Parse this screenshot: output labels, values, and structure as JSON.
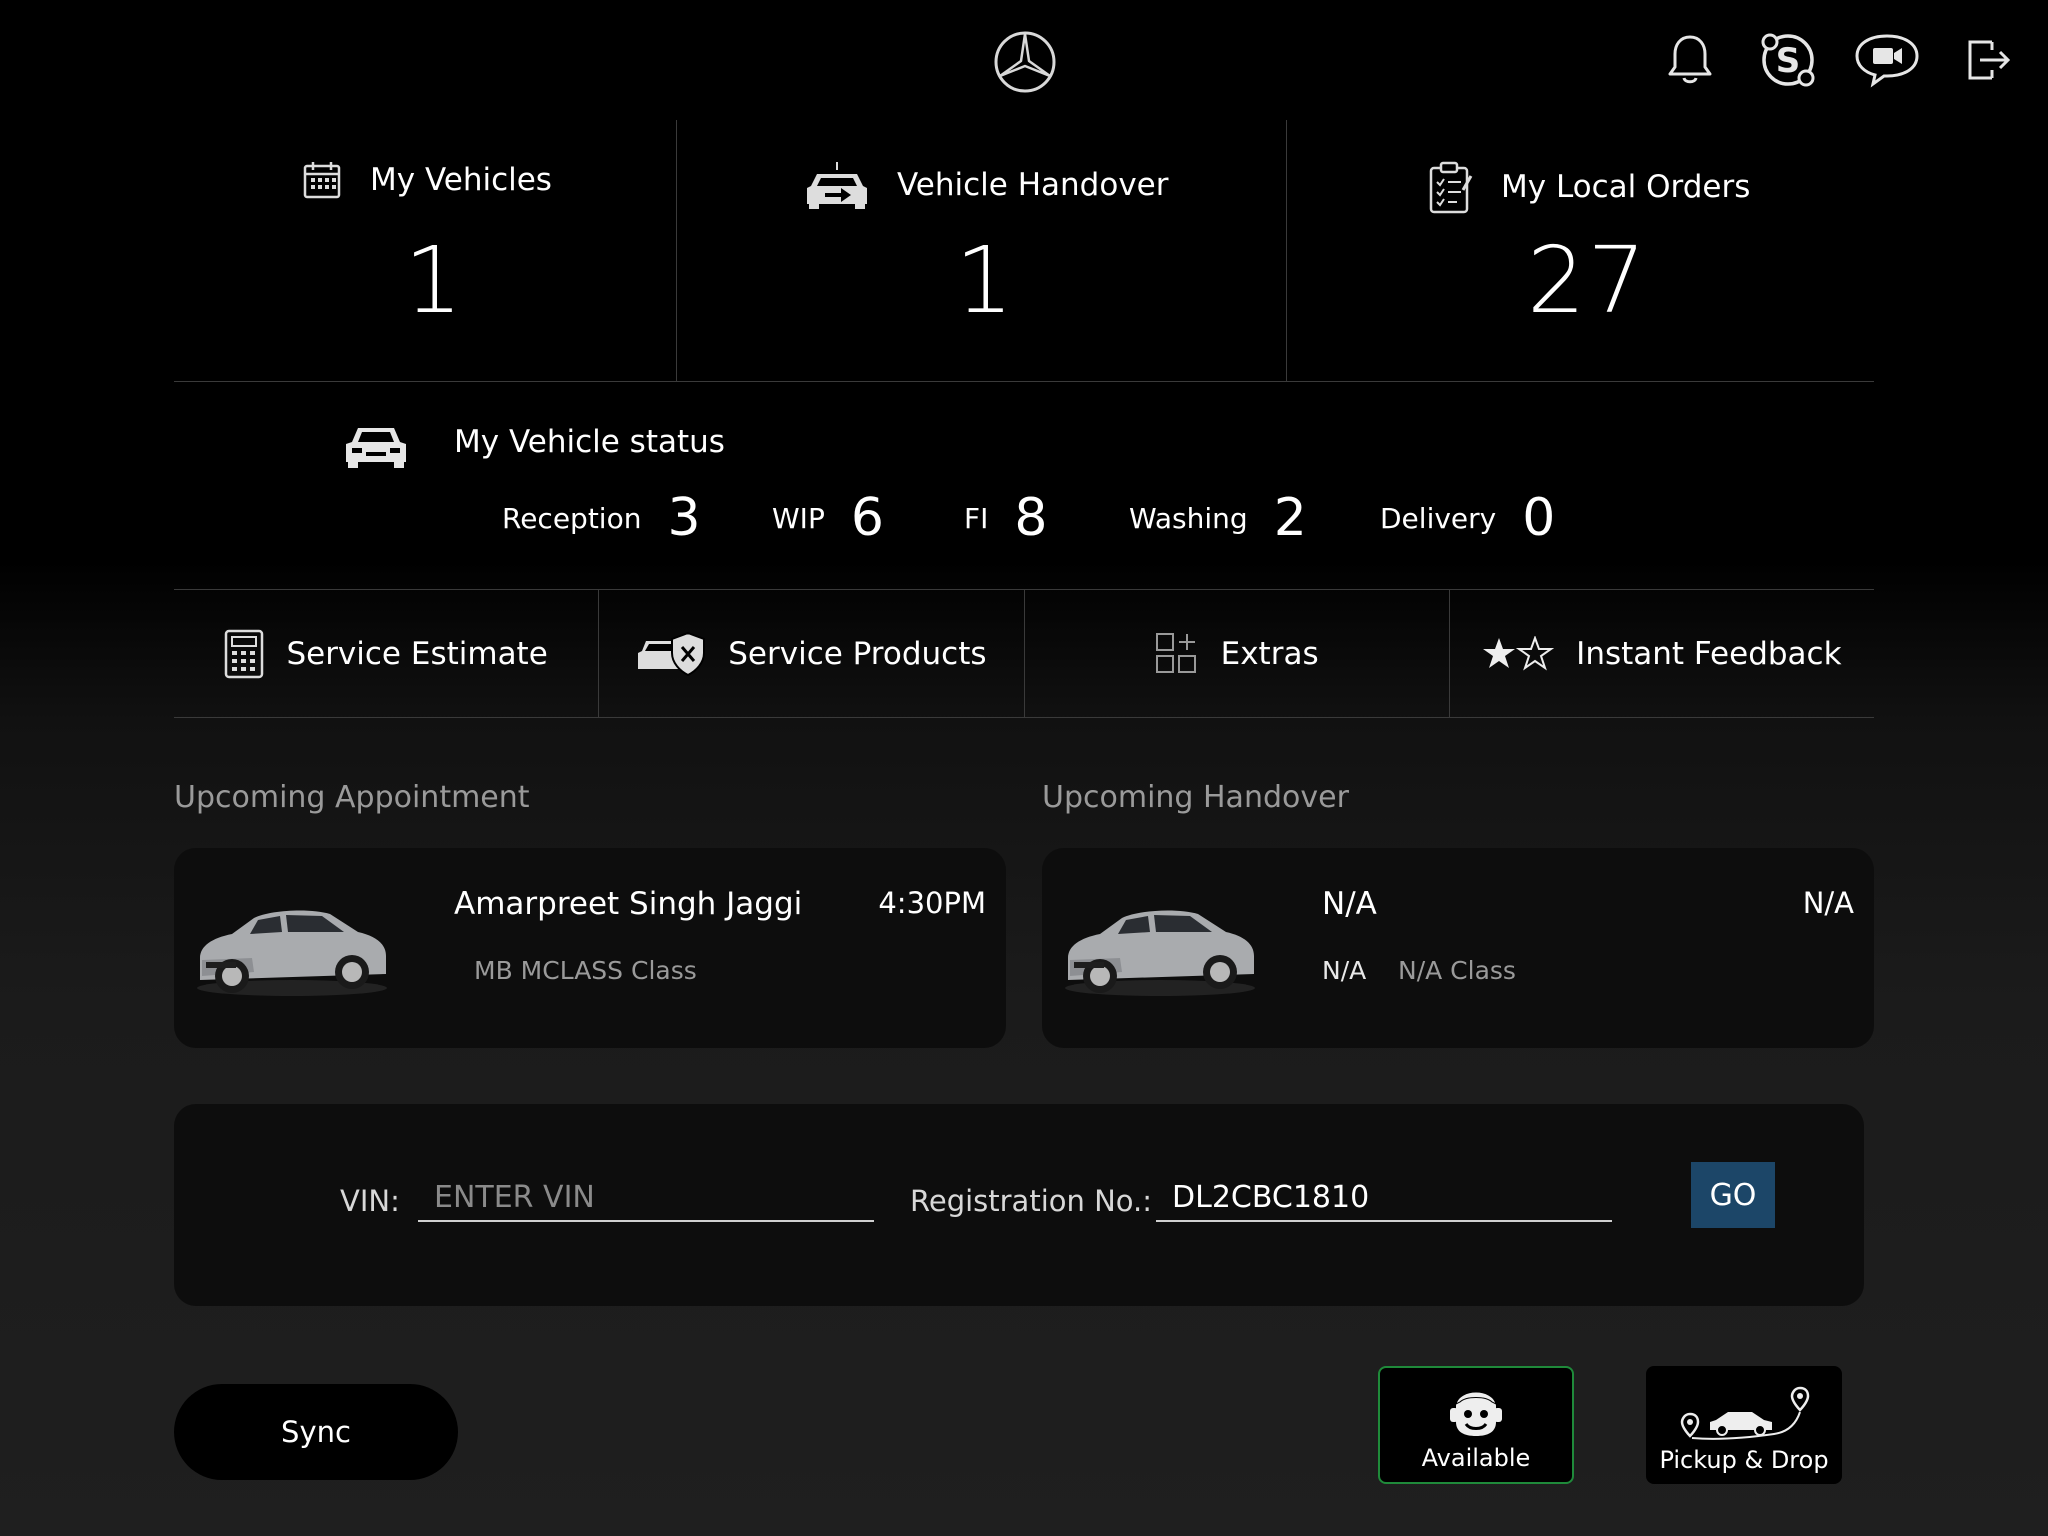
{
  "header": {
    "logo": "mercedes-star-logo",
    "icons": [
      "bell-icon",
      "skype-icon",
      "video-chat-icon",
      "logout-icon"
    ]
  },
  "stats": [
    {
      "label": "My Vehicles",
      "value": "1",
      "icon": "calendar-icon"
    },
    {
      "label": "Vehicle Handover",
      "value": "1",
      "icon": "car-handover-icon"
    },
    {
      "label": "My Local Orders",
      "value": "27",
      "icon": "clipboard-icon"
    }
  ],
  "vehicle_status": {
    "title": "My Vehicle status",
    "items": [
      {
        "label": "Reception",
        "value": "3"
      },
      {
        "label": "WIP",
        "value": "6"
      },
      {
        "label": "FI",
        "value": "8"
      },
      {
        "label": "Washing",
        "value": "2"
      },
      {
        "label": "Delivery",
        "value": "0"
      }
    ]
  },
  "actions": [
    {
      "label": "Service Estimate",
      "icon": "calculator-icon"
    },
    {
      "label": "Service Products",
      "icon": "car-shield-icon"
    },
    {
      "label": "Extras",
      "icon": "grid-plus-icon"
    },
    {
      "label": "Instant Feedback",
      "icon": "stars-icon"
    }
  ],
  "upcoming_appointment": {
    "title": "Upcoming Appointment",
    "name": "Amarpreet Singh Jaggi",
    "time": "4:30PM",
    "model": "MB MCLASS Class"
  },
  "upcoming_handover": {
    "title": "Upcoming Handover",
    "name": "N/A",
    "time": "N/A",
    "reg": "N/A",
    "model": "N/A Class"
  },
  "search": {
    "vin_label": "VIN:",
    "vin_placeholder": "ENTER VIN",
    "vin_value": "",
    "reg_label": "Registration No.:",
    "reg_value": "DL2CBC1810",
    "go_label": "GO"
  },
  "bottom": {
    "sync_label": "Sync",
    "available_label": "Available",
    "pickup_label": "Pickup & Drop"
  },
  "colors": {
    "go_button": "#1c4668",
    "available_border": "#1f8a3a",
    "muted_text": "#9a9a9a"
  }
}
